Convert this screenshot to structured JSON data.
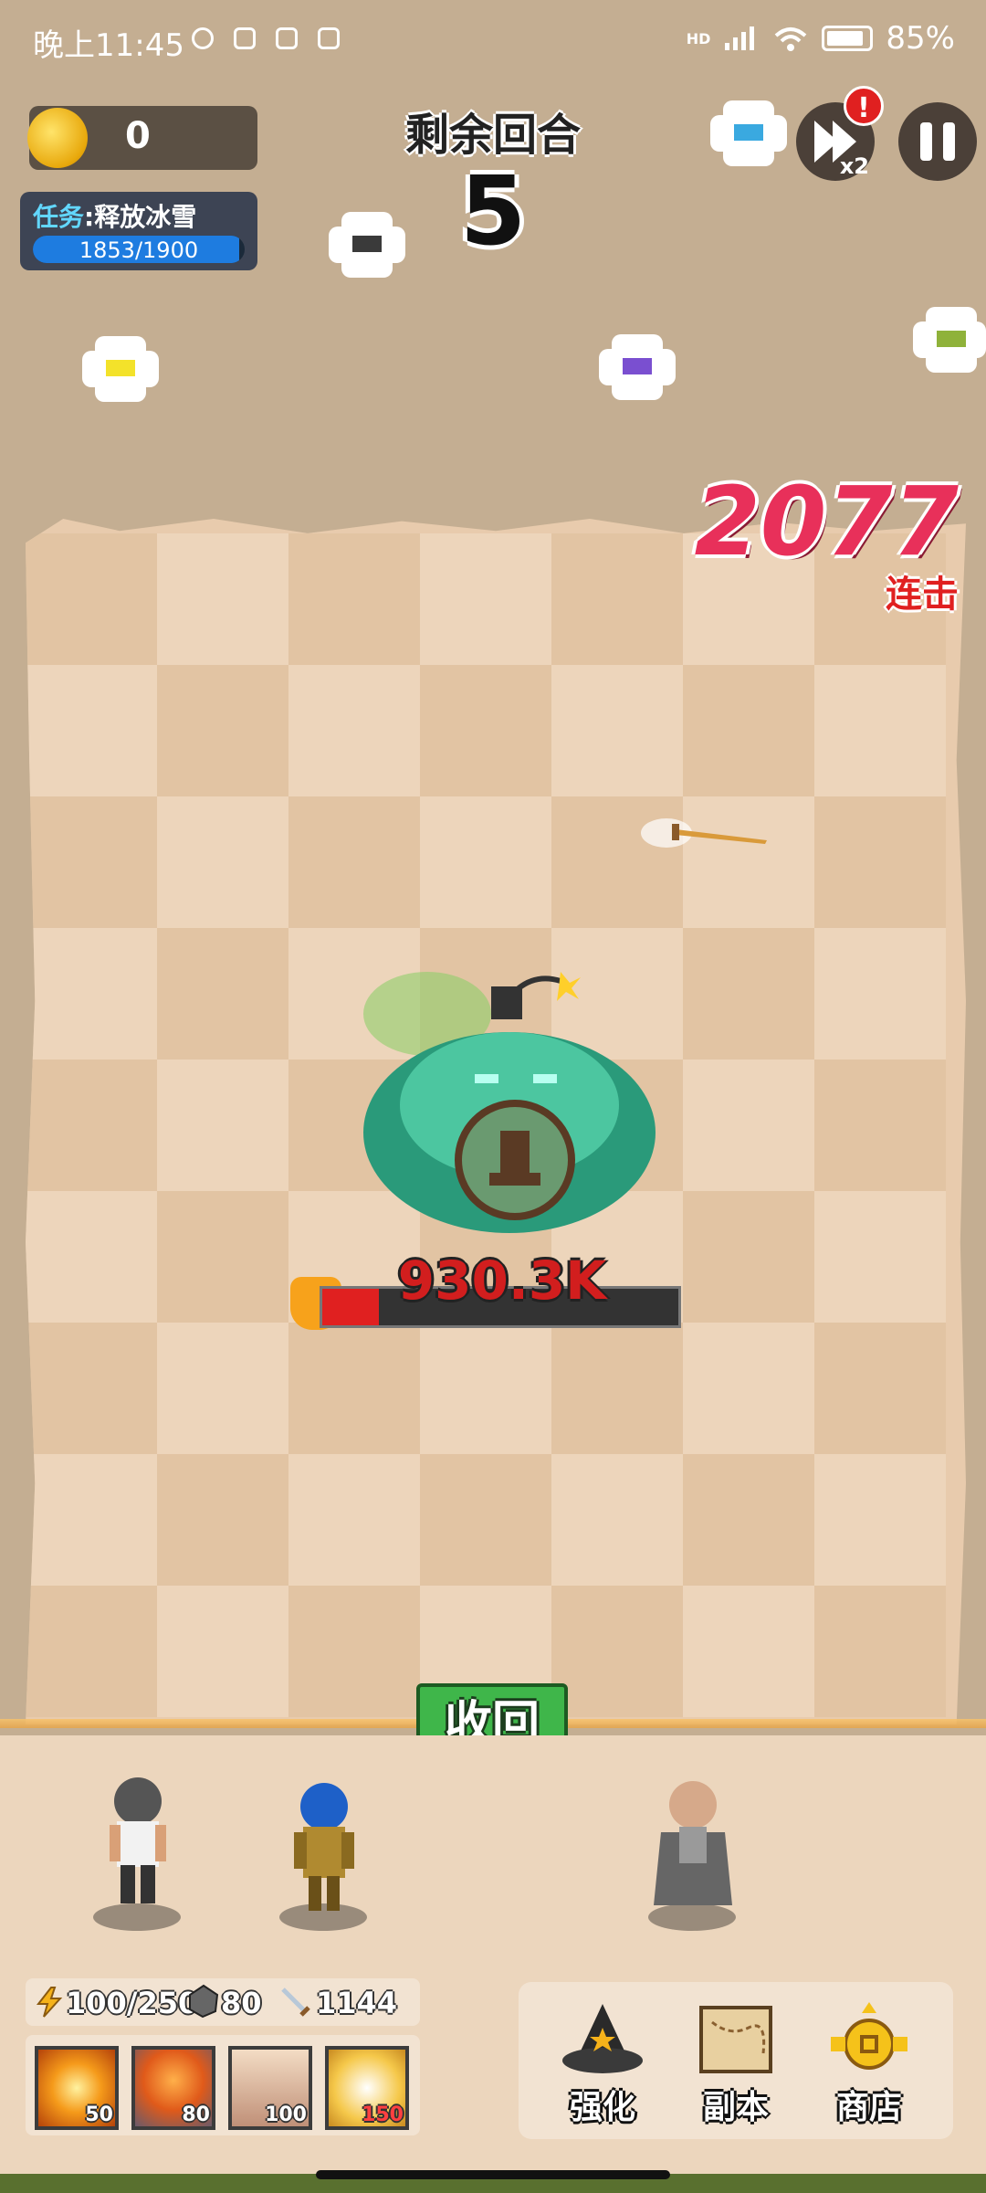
{
  "status_bar": {
    "time": "晚上11:45",
    "network": "HD",
    "battery": "85%"
  },
  "hud": {
    "coins": "0",
    "task_label": "任务",
    "task_name": ":释放冰雪",
    "task_progress_text": "1853/1900",
    "task_progress_fraction": 0.975,
    "rounds_title": "剩余回合",
    "rounds_left": "5",
    "speed_label": "x2",
    "alert_badge": "!"
  },
  "combo": {
    "count": "2077",
    "label": "连击"
  },
  "boss": {
    "hp_text": "930.3K",
    "hp_fraction": 0.16
  },
  "recall_button": "收回",
  "resources": {
    "energy": "100/250",
    "ore": "80",
    "attack": "1144"
  },
  "skills": [
    {
      "name": "explosion",
      "cost": "50"
    },
    {
      "name": "meteor",
      "cost": "80"
    },
    {
      "name": "spikes",
      "cost": "100"
    },
    {
      "name": "angel",
      "cost": "150"
    }
  ],
  "menu": {
    "upgrade": "强化",
    "dungeon": "副本",
    "shop": "商店"
  },
  "colors": {
    "board_dark": "#e2c4a3",
    "board_light": "#edd5bb",
    "combo": "#e8305a",
    "button_green": "#3fb64a"
  }
}
